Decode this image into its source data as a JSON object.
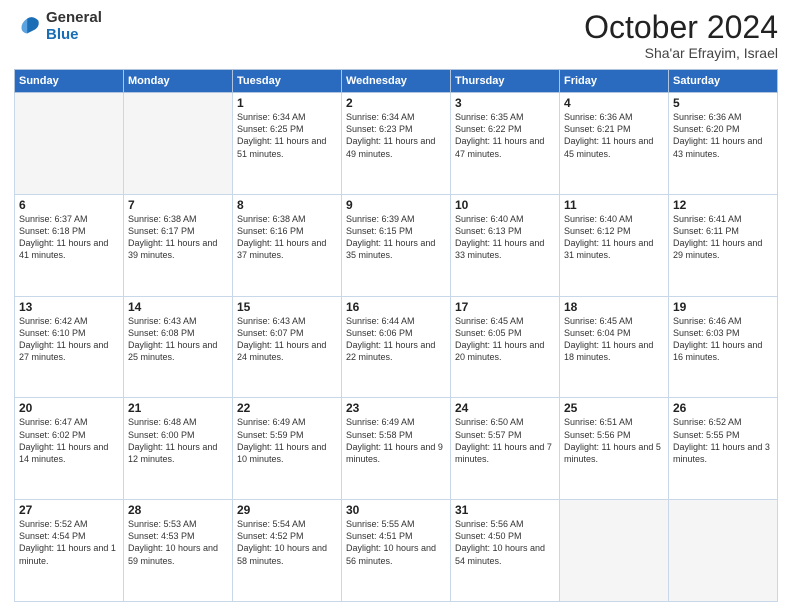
{
  "logo": {
    "general": "General",
    "blue": "Blue"
  },
  "header": {
    "month": "October 2024",
    "location": "Sha'ar Efrayim, Israel"
  },
  "weekdays": [
    "Sunday",
    "Monday",
    "Tuesday",
    "Wednesday",
    "Thursday",
    "Friday",
    "Saturday"
  ],
  "weeks": [
    [
      {
        "day": "",
        "empty": true
      },
      {
        "day": "",
        "empty": true
      },
      {
        "day": "1",
        "sunrise": "6:34 AM",
        "sunset": "6:25 PM",
        "daylight": "11 hours and 51 minutes."
      },
      {
        "day": "2",
        "sunrise": "6:34 AM",
        "sunset": "6:23 PM",
        "daylight": "11 hours and 49 minutes."
      },
      {
        "day": "3",
        "sunrise": "6:35 AM",
        "sunset": "6:22 PM",
        "daylight": "11 hours and 47 minutes."
      },
      {
        "day": "4",
        "sunrise": "6:36 AM",
        "sunset": "6:21 PM",
        "daylight": "11 hours and 45 minutes."
      },
      {
        "day": "5",
        "sunrise": "6:36 AM",
        "sunset": "6:20 PM",
        "daylight": "11 hours and 43 minutes."
      }
    ],
    [
      {
        "day": "6",
        "sunrise": "6:37 AM",
        "sunset": "6:18 PM",
        "daylight": "11 hours and 41 minutes."
      },
      {
        "day": "7",
        "sunrise": "6:38 AM",
        "sunset": "6:17 PM",
        "daylight": "11 hours and 39 minutes."
      },
      {
        "day": "8",
        "sunrise": "6:38 AM",
        "sunset": "6:16 PM",
        "daylight": "11 hours and 37 minutes."
      },
      {
        "day": "9",
        "sunrise": "6:39 AM",
        "sunset": "6:15 PM",
        "daylight": "11 hours and 35 minutes."
      },
      {
        "day": "10",
        "sunrise": "6:40 AM",
        "sunset": "6:13 PM",
        "daylight": "11 hours and 33 minutes."
      },
      {
        "day": "11",
        "sunrise": "6:40 AM",
        "sunset": "6:12 PM",
        "daylight": "11 hours and 31 minutes."
      },
      {
        "day": "12",
        "sunrise": "6:41 AM",
        "sunset": "6:11 PM",
        "daylight": "11 hours and 29 minutes."
      }
    ],
    [
      {
        "day": "13",
        "sunrise": "6:42 AM",
        "sunset": "6:10 PM",
        "daylight": "11 hours and 27 minutes."
      },
      {
        "day": "14",
        "sunrise": "6:43 AM",
        "sunset": "6:08 PM",
        "daylight": "11 hours and 25 minutes."
      },
      {
        "day": "15",
        "sunrise": "6:43 AM",
        "sunset": "6:07 PM",
        "daylight": "11 hours and 24 minutes."
      },
      {
        "day": "16",
        "sunrise": "6:44 AM",
        "sunset": "6:06 PM",
        "daylight": "11 hours and 22 minutes."
      },
      {
        "day": "17",
        "sunrise": "6:45 AM",
        "sunset": "6:05 PM",
        "daylight": "11 hours and 20 minutes."
      },
      {
        "day": "18",
        "sunrise": "6:45 AM",
        "sunset": "6:04 PM",
        "daylight": "11 hours and 18 minutes."
      },
      {
        "day": "19",
        "sunrise": "6:46 AM",
        "sunset": "6:03 PM",
        "daylight": "11 hours and 16 minutes."
      }
    ],
    [
      {
        "day": "20",
        "sunrise": "6:47 AM",
        "sunset": "6:02 PM",
        "daylight": "11 hours and 14 minutes."
      },
      {
        "day": "21",
        "sunrise": "6:48 AM",
        "sunset": "6:00 PM",
        "daylight": "11 hours and 12 minutes."
      },
      {
        "day": "22",
        "sunrise": "6:49 AM",
        "sunset": "5:59 PM",
        "daylight": "11 hours and 10 minutes."
      },
      {
        "day": "23",
        "sunrise": "6:49 AM",
        "sunset": "5:58 PM",
        "daylight": "11 hours and 9 minutes."
      },
      {
        "day": "24",
        "sunrise": "6:50 AM",
        "sunset": "5:57 PM",
        "daylight": "11 hours and 7 minutes."
      },
      {
        "day": "25",
        "sunrise": "6:51 AM",
        "sunset": "5:56 PM",
        "daylight": "11 hours and 5 minutes."
      },
      {
        "day": "26",
        "sunrise": "6:52 AM",
        "sunset": "5:55 PM",
        "daylight": "11 hours and 3 minutes."
      }
    ],
    [
      {
        "day": "27",
        "sunrise": "5:52 AM",
        "sunset": "4:54 PM",
        "daylight": "11 hours and 1 minute."
      },
      {
        "day": "28",
        "sunrise": "5:53 AM",
        "sunset": "4:53 PM",
        "daylight": "10 hours and 59 minutes."
      },
      {
        "day": "29",
        "sunrise": "5:54 AM",
        "sunset": "4:52 PM",
        "daylight": "10 hours and 58 minutes."
      },
      {
        "day": "30",
        "sunrise": "5:55 AM",
        "sunset": "4:51 PM",
        "daylight": "10 hours and 56 minutes."
      },
      {
        "day": "31",
        "sunrise": "5:56 AM",
        "sunset": "4:50 PM",
        "daylight": "10 hours and 54 minutes."
      },
      {
        "day": "",
        "empty": true
      },
      {
        "day": "",
        "empty": true
      }
    ]
  ],
  "labels": {
    "sunrise": "Sunrise:",
    "sunset": "Sunset:",
    "daylight": "Daylight:"
  }
}
